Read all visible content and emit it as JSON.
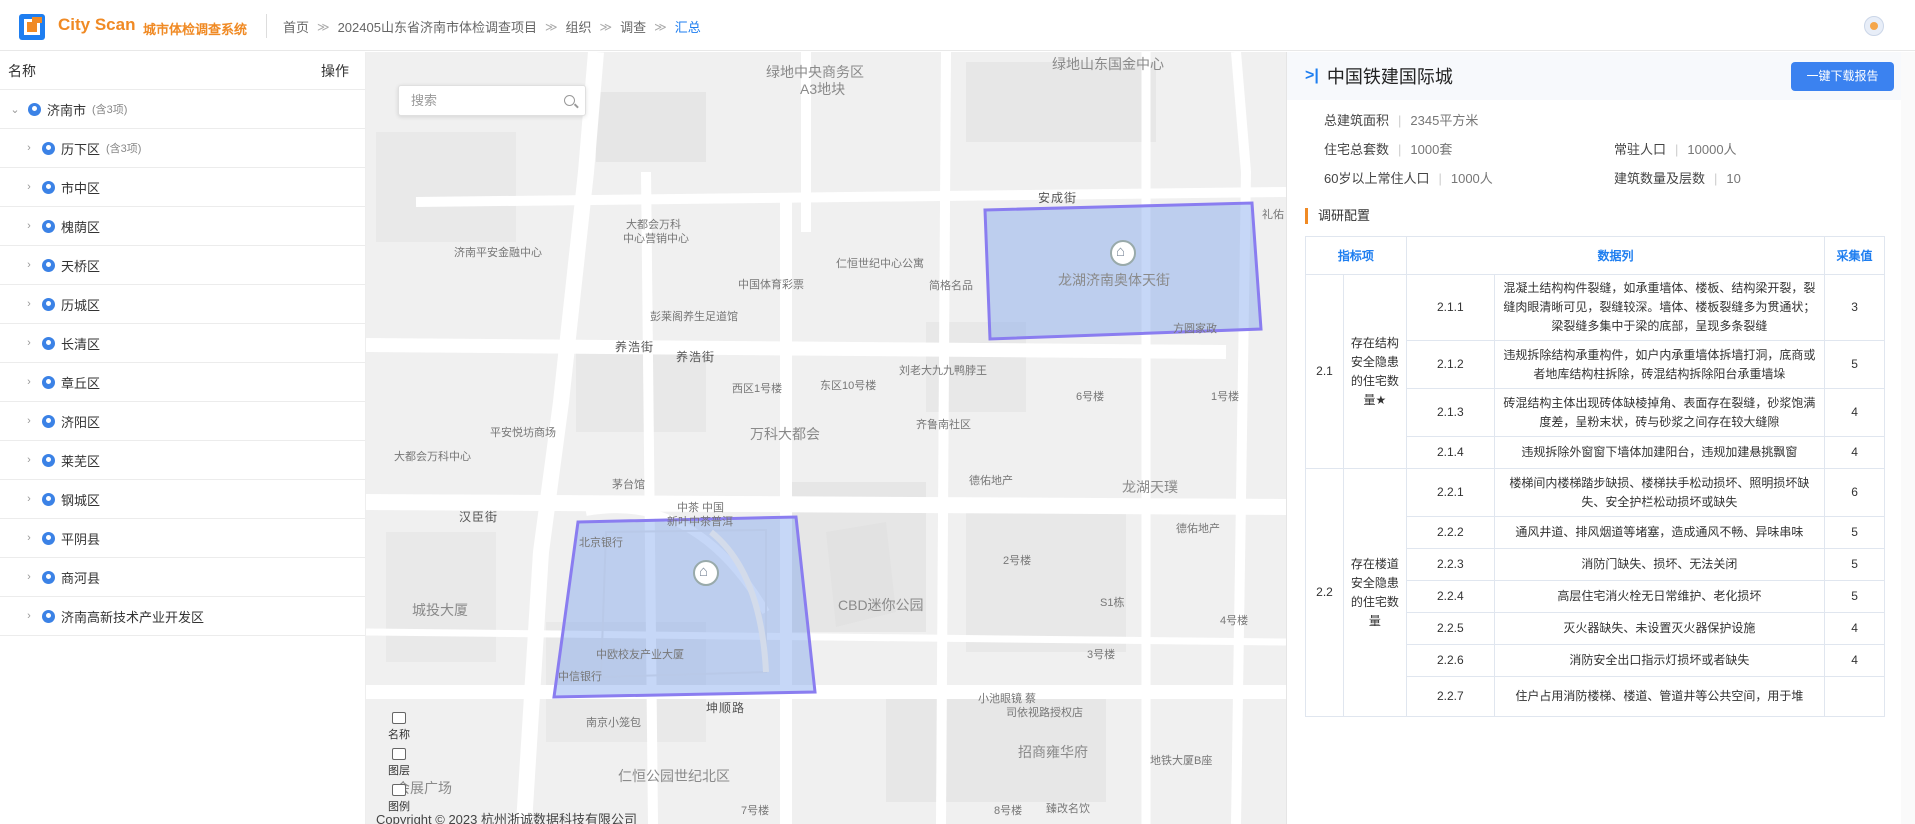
{
  "header": {
    "brand": "City Scan",
    "brand_sub": "城市体检调查系统",
    "breadcrumb": [
      "首页",
      "202405山东省济南市体检调查项目",
      "组织",
      "调查",
      "汇总"
    ]
  },
  "left_panel": {
    "col_name": "名称",
    "col_action": "操作",
    "root": {
      "label": "济南市",
      "count": "(含3项)"
    },
    "children": [
      {
        "label": "历下区",
        "count": "(含3项)"
      },
      {
        "label": "市中区",
        "count": ""
      },
      {
        "label": "槐荫区",
        "count": ""
      },
      {
        "label": "天桥区",
        "count": ""
      },
      {
        "label": "历城区",
        "count": ""
      },
      {
        "label": "长清区",
        "count": ""
      },
      {
        "label": "章丘区",
        "count": ""
      },
      {
        "label": "济阳区",
        "count": ""
      },
      {
        "label": "莱芜区",
        "count": ""
      },
      {
        "label": "钢城区",
        "count": ""
      },
      {
        "label": "平阴县",
        "count": ""
      },
      {
        "label": "商河县",
        "count": ""
      },
      {
        "label": "济南高新技术产业开发区",
        "count": ""
      }
    ]
  },
  "map": {
    "search_placeholder": "搜索",
    "tools": [
      "名称",
      "图层",
      "图例"
    ],
    "copyright": "Copyright © 2023 杭州浙诚数据科技有限公司",
    "labels": {
      "l1": "绿地中央商务区",
      "l1b": "A3地块",
      "l2": "绿地山东国金中心",
      "l3": "安成街",
      "l4": "大都会万科",
      "l4b": "中心营销中心",
      "l5": "济南平安金融中心",
      "l6": "仁恒世纪中心公寓",
      "l7": "中国体育彩票",
      "l8": "简格名品",
      "l9": "龙湖济南奥体天街",
      "l10": "方圆家政",
      "l11": "彭莱阁养生足道馆",
      "l12": "养浩街",
      "l13": "养浩街",
      "l14": "刘老大九九鸭脖王",
      "l15": "西区1号楼",
      "l16": "东区10号楼",
      "l17": "6号楼",
      "l18": "1号楼",
      "l19": "万科大都会",
      "l20": "齐鲁南社区",
      "l21": "平安悦坊商场",
      "l22": "大都会万科中心",
      "l23": "茅台馆",
      "l24": "德佑地产",
      "l25": "龙湖天璞",
      "l26": "汉臣街",
      "l27": "中茶 中国",
      "l27b": "新叶中茶普洱",
      "l28": "北京银行",
      "l29": "德佑地产",
      "l30": "2号楼",
      "l31": "城投大厦",
      "l32": "CBD迷你公园",
      "l33": "S1栋",
      "l34": "4号楼",
      "l35": "中欧校友产业大厦",
      "l36": "中信银行",
      "l37": "3号楼",
      "l38": "坤顺路",
      "l39": "小池眼镜 蔡",
      "l39b": "司依视路授权店",
      "l40": "南京小笼包",
      "l41": "招商雍华府",
      "l42": "地铁大厦B座",
      "l43": "会展广场",
      "l44": "仁恒公园世纪北区",
      "l45": "7号楼",
      "l46": "8号楼",
      "l47": "臻改名饮",
      "l48": "礼佑"
    }
  },
  "right_panel": {
    "title": "中国铁建国际城",
    "download_button": "一键下载报告",
    "info": {
      "total_area_label": "总建筑面积",
      "total_area_value": "2345平方米",
      "households_label": "住宅总套数",
      "households_value": "1000套",
      "resident_label": "常驻人口",
      "resident_value": "10000人",
      "elderly_label": "60岁以上常住人口",
      "elderly_value": "1000人",
      "buildings_label": "建筑数量及层数",
      "buildings_value": "10"
    },
    "section_title": "调研配置",
    "table": {
      "headers": [
        "指标项",
        "数据列",
        "采集值"
      ],
      "groups": [
        {
          "id": "2.1",
          "name": "存在结构安全隐患的住宅数量★",
          "rows": [
            {
              "code": "2.1.1",
              "desc": "混凝土结构构件裂缝，如承重墙体、楼板、结构梁开裂，裂缝肉眼清晰可见，裂缝较深。墙体、楼板裂缝多为贯通状；梁裂缝多集中于梁的底部，呈现多条裂缝",
              "value": "3"
            },
            {
              "code": "2.1.2",
              "desc": "违规拆除结构承重构件，如户内承重墙体拆墙打洞，底商或者地库结构柱拆除，砖混结构拆除阳台承重墙垛",
              "value": "5"
            },
            {
              "code": "2.1.3",
              "desc": "砖混结构主体出现砖体缺棱掉角、表面存在裂缝，砂浆饱满度差，呈粉末状，砖与砂浆之间存在较大缝隙",
              "value": "4"
            },
            {
              "code": "2.1.4",
              "desc": "违规拆除外窗窗下墙体加建阳台，违规加建悬挑飘窗",
              "value": "4"
            }
          ]
        },
        {
          "id": "2.2",
          "name": "存在楼道安全隐患的住宅数量",
          "rows": [
            {
              "code": "2.2.1",
              "desc": "楼梯间内楼梯踏步缺损、楼梯扶手松动损坏、照明损坏缺失、安全护栏松动损坏或缺失",
              "value": "6"
            },
            {
              "code": "2.2.2",
              "desc": "通风井道、排风烟道等堵塞，造成通风不畅、异味串味",
              "value": "5"
            },
            {
              "code": "2.2.3",
              "desc": "消防门缺失、损坏、无法关闭",
              "value": "5"
            },
            {
              "code": "2.2.4",
              "desc": "高层住宅消火栓无日常维护、老化损坏",
              "value": "5"
            },
            {
              "code": "2.2.5",
              "desc": "灭火器缺失、未设置灭火器保护设施",
              "value": "4"
            },
            {
              "code": "2.2.6",
              "desc": "消防安全出口指示灯损坏或者缺失",
              "value": "4"
            },
            {
              "code": "2.2.7",
              "desc": "住户占用消防楼梯、楼道、管道井等公共空间，用于堆",
              "value": ""
            }
          ]
        }
      ]
    }
  }
}
